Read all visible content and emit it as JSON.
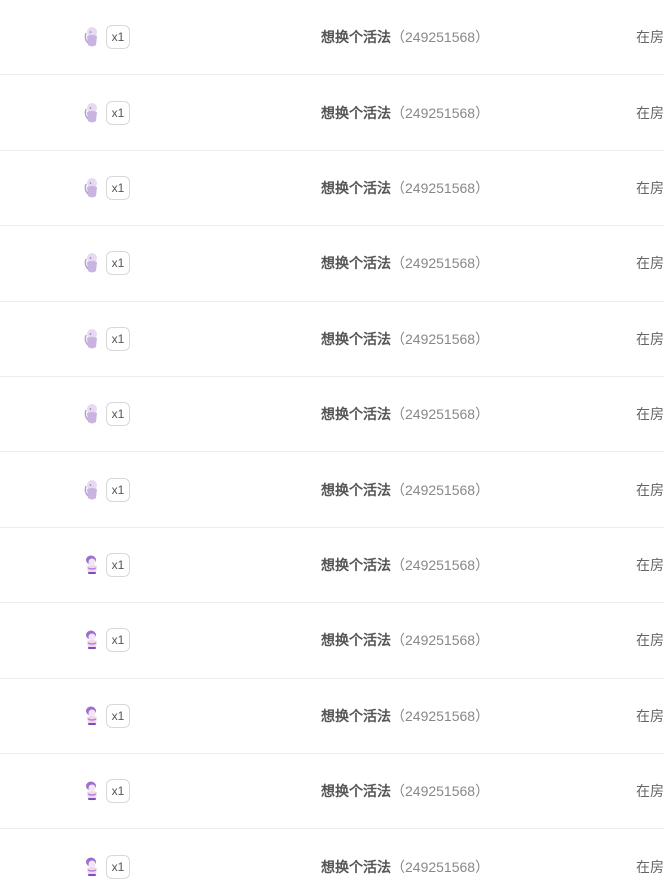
{
  "gift_list": {
    "rows": [
      {
        "gift_icon": "lavender-figure-icon",
        "count": "x1",
        "user_name": "想换个活法",
        "user_id": "（249251568）",
        "status": "在房"
      },
      {
        "gift_icon": "lavender-figure-icon",
        "count": "x1",
        "user_name": "想换个活法",
        "user_id": "（249251568）",
        "status": "在房"
      },
      {
        "gift_icon": "lavender-figure-icon",
        "count": "x1",
        "user_name": "想换个活法",
        "user_id": "（249251568）",
        "status": "在房"
      },
      {
        "gift_icon": "lavender-figure-icon",
        "count": "x1",
        "user_name": "想换个活法",
        "user_id": "（249251568）",
        "status": "在房"
      },
      {
        "gift_icon": "lavender-figure-icon",
        "count": "x1",
        "user_name": "想换个活法",
        "user_id": "（249251568）",
        "status": "在房"
      },
      {
        "gift_icon": "lavender-figure-icon",
        "count": "x1",
        "user_name": "想换个活法",
        "user_id": "（249251568）",
        "status": "在房"
      },
      {
        "gift_icon": "lavender-figure-icon",
        "count": "x1",
        "user_name": "想换个活法",
        "user_id": "（249251568）",
        "status": "在房"
      },
      {
        "gift_icon": "purple-figure-icon",
        "count": "x1",
        "user_name": "想换个活法",
        "user_id": "（249251568）",
        "status": "在房"
      },
      {
        "gift_icon": "purple-figure-icon",
        "count": "x1",
        "user_name": "想换个活法",
        "user_id": "（249251568）",
        "status": "在房"
      },
      {
        "gift_icon": "purple-figure-icon",
        "count": "x1",
        "user_name": "想换个活法",
        "user_id": "（249251568）",
        "status": "在房"
      },
      {
        "gift_icon": "purple-figure-icon",
        "count": "x1",
        "user_name": "想换个活法",
        "user_id": "（249251568）",
        "status": "在房"
      },
      {
        "gift_icon": "purple-figure-icon",
        "count": "x1",
        "user_name": "想换个活法",
        "user_id": "（249251568）",
        "status": "在房"
      }
    ]
  },
  "colors": {
    "lavender_icon": "#c9b3e0",
    "purple_icon": "#9b6fd1",
    "divider": "#ececec",
    "name_text": "#555555",
    "id_text": "#888888"
  }
}
